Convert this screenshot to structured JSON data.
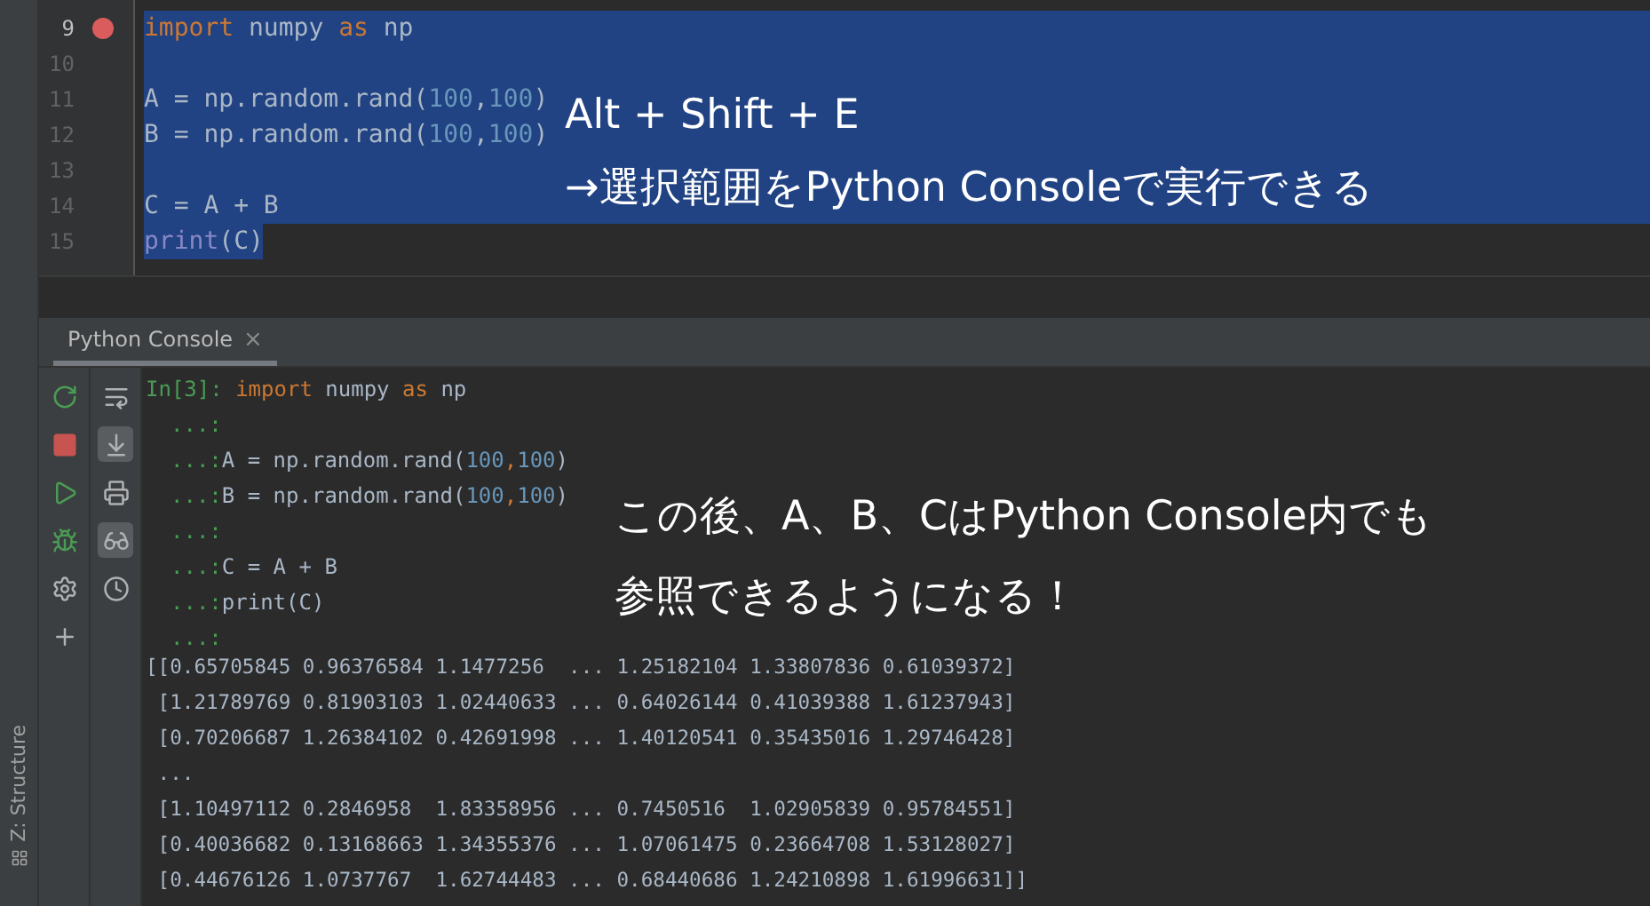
{
  "editor": {
    "lines": [
      {
        "number": "9",
        "breakpoint": true,
        "selected": true,
        "tokens": [
          {
            "text": "import",
            "kind": "keyword"
          },
          {
            "text": " numpy ",
            "kind": "plain"
          },
          {
            "text": "as",
            "kind": "keyword"
          },
          {
            "text": " np",
            "kind": "plain"
          }
        ]
      },
      {
        "number": "10",
        "selected": true
      },
      {
        "number": "11",
        "selected": true,
        "tokens": [
          {
            "text": "A = np.random.rand(",
            "kind": "plain"
          },
          {
            "text": "100",
            "kind": "number"
          },
          {
            "text": ",",
            "kind": "plain"
          },
          {
            "text": "100",
            "kind": "number"
          },
          {
            "text": ")",
            "kind": "plain"
          }
        ]
      },
      {
        "number": "12",
        "selected": true,
        "tokens": [
          {
            "text": "B = np.random.rand(",
            "kind": "plain"
          },
          {
            "text": "100",
            "kind": "number"
          },
          {
            "text": ",",
            "kind": "plain"
          },
          {
            "text": "100",
            "kind": "number"
          },
          {
            "text": ")",
            "kind": "plain"
          }
        ]
      },
      {
        "number": "13",
        "selected": true
      },
      {
        "number": "14",
        "selected": true,
        "tokens": [
          {
            "text": "C = A + B",
            "kind": "plain"
          }
        ]
      },
      {
        "number": "15",
        "selected": true,
        "tokens": [
          {
            "text": "print",
            "kind": "builtin"
          },
          {
            "text": "(C)",
            "kind": "plain"
          }
        ]
      }
    ],
    "annotation": [
      "Alt + Shift + E",
      "→選択範囲をPython Consoleで実行できる"
    ]
  },
  "console_tab": {
    "label": "Python Console",
    "close": "×",
    "selected": true
  },
  "toolbar_secondary": [
    {
      "selected": false
    },
    {
      "selected": true
    },
    {
      "selected": false
    },
    {
      "selected": true
    },
    {
      "selected": false
    }
  ],
  "console": {
    "input": [
      {
        "prompt": "In[3]:",
        "tokens": [
          {
            "text": " import",
            "kind": "keyword"
          },
          {
            "text": " numpy ",
            "kind": "plain"
          },
          {
            "text": "as",
            "kind": "keyword"
          },
          {
            "text": " np",
            "kind": "plain"
          }
        ]
      },
      {
        "prompt": "...:"
      },
      {
        "prompt": "...:",
        "tokens": [
          {
            "text": "A = np.random.rand(",
            "kind": "plain"
          },
          {
            "text": "100",
            "kind": "number"
          },
          {
            "text": ",",
            "kind": "keyword"
          },
          {
            "text": "100",
            "kind": "number"
          },
          {
            "text": ")",
            "kind": "plain"
          }
        ]
      },
      {
        "prompt": "...:",
        "tokens": [
          {
            "text": "B = np.random.rand(",
            "kind": "plain"
          },
          {
            "text": "100",
            "kind": "number"
          },
          {
            "text": ",",
            "kind": "keyword"
          },
          {
            "text": "100",
            "kind": "number"
          },
          {
            "text": ")",
            "kind": "plain"
          }
        ]
      },
      {
        "prompt": "...:"
      },
      {
        "prompt": "...:",
        "tokens": [
          {
            "text": "C = A + B",
            "kind": "plain"
          }
        ]
      },
      {
        "prompt": "...:",
        "tokens": [
          {
            "text": "print(C)",
            "kind": "plain"
          }
        ]
      },
      {
        "prompt": "...:"
      }
    ],
    "output": [
      "[[0.65705845 0.96376584 1.1477256  ... 1.25182104 1.33807836 0.61039372]",
      " [1.21789769 0.81903103 1.02440633 ... 0.64026144 0.41039388 1.61237943]",
      " [0.70206687 1.26384102 0.42691998 ... 1.40120541 0.35435016 1.29746428]",
      " ...",
      " [1.10497112 0.2846958  1.83358956 ... 0.7450516  1.02905839 0.95784551]",
      " [0.40036682 0.13168663 1.34355376 ... 1.07061475 0.23664708 1.53128027]",
      " [0.44676126 1.0737767  1.62744483 ... 0.68440686 1.24210898 1.61996631]]"
    ],
    "annotation": [
      "この後、A、B、CはPython Console内でも",
      "参照できるようになる！"
    ]
  },
  "side_tool": {
    "label": "Z: Structure"
  }
}
